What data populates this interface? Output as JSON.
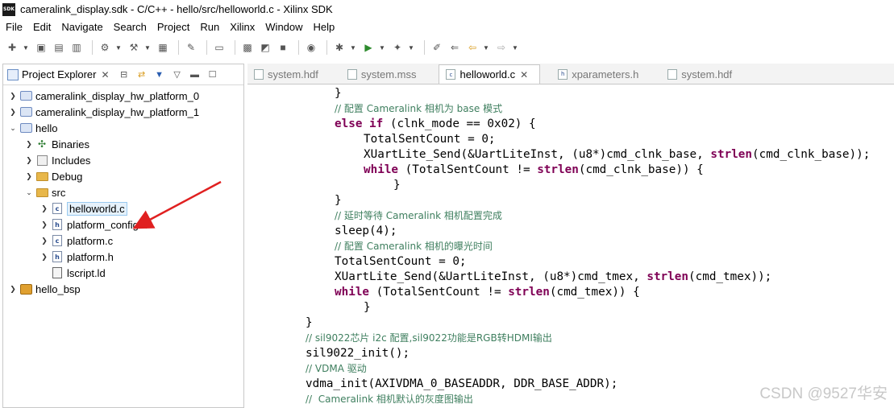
{
  "window": {
    "title": "cameralink_display.sdk - C/C++ - hello/src/helloworld.c - Xilinx SDK",
    "app_icon_text": "SDK"
  },
  "menu": [
    "File",
    "Edit",
    "Navigate",
    "Search",
    "Project",
    "Run",
    "Xilinx",
    "Window",
    "Help"
  ],
  "project_explorer": {
    "title": "Project Explorer",
    "tree": [
      {
        "label": "cameralink_display_hw_platform_0",
        "icon": "project-icon",
        "expanded": false
      },
      {
        "label": "cameralink_display_hw_platform_1",
        "icon": "project-icon",
        "expanded": false
      },
      {
        "label": "hello",
        "icon": "project-icon",
        "expanded": true
      },
      {
        "label": "Binaries",
        "icon": "binaries-icon",
        "expanded": false
      },
      {
        "label": "Includes",
        "icon": "includes-icon",
        "expanded": false
      },
      {
        "label": "Debug",
        "icon": "folder-icon",
        "expanded": false
      },
      {
        "label": "src",
        "icon": "folder-icon",
        "expanded": true
      },
      {
        "label": "helloworld.c",
        "icon": "c-file-icon",
        "selected": true
      },
      {
        "label": "platform_config.h",
        "icon": "h-file-icon"
      },
      {
        "label": "platform.c",
        "icon": "c-file-icon"
      },
      {
        "label": "platform.h",
        "icon": "h-file-icon"
      },
      {
        "label": "lscript.ld",
        "icon": "ld-file-icon"
      },
      {
        "label": "hello_bsp",
        "icon": "bsp-icon",
        "expanded": false
      }
    ]
  },
  "editor": {
    "tabs": [
      {
        "label": "system.hdf",
        "active": false
      },
      {
        "label": "system.mss",
        "active": false
      },
      {
        "label": "helloworld.c",
        "active": true
      },
      {
        "label": "xparameters.h",
        "active": false
      },
      {
        "label": "system.hdf",
        "active": false
      }
    ],
    "code": {
      "l1": "}",
      "l2": "// 配置 Cameralink 相机为 base 模式",
      "l3_kw1": "else if",
      "l3_rest": " (clnk_mode == 0x02) {",
      "l4": "TotalSentCount = 0;",
      "l5_a": "XUartLite_Send(&UartLiteInst, (u8*)cmd_clnk_base, ",
      "l5_kw": "strlen",
      "l5_b": "(cmd_clnk_base));",
      "l6_kw": "while",
      "l6_a": " (TotalSentCount != ",
      "l6_kw2": "strlen",
      "l6_b": "(cmd_clnk_base)) {",
      "l7": "}",
      "l8": "}",
      "l9": "// 延时等待 Cameralink 相机配置完成",
      "l10": "sleep(4);",
      "l11": "// 配置 Cameralink 相机的曝光时间",
      "l12": "TotalSentCount = 0;",
      "l13_a": "XUartLite_Send(&UartLiteInst, (u8*)cmd_tmex, ",
      "l13_kw": "strlen",
      "l13_b": "(cmd_tmex));",
      "l14_kw": "while",
      "l14_a": " (TotalSentCount != ",
      "l14_kw2": "strlen",
      "l14_b": "(cmd_tmex)) {",
      "l15": "}",
      "l16": "}",
      "l17": "// sil9022芯片 i2c 配置,sil9022功能是RGB转HDMI输出",
      "l18": "sil9022_init();",
      "l19": "// VDMA 驱动",
      "l20": "vdma_init(AXIVDMA_0_BASEADDR, DDR_BASE_ADDR);",
      "l21": "//  Cameralink 相机默认的灰度图输出"
    }
  },
  "watermark": "CSDN @9527华安",
  "colors": {
    "keyword": "#7f0055",
    "comment": "#3f7f5f",
    "annotation_arrow": "#e02020",
    "selection": "#e5f1fb"
  }
}
